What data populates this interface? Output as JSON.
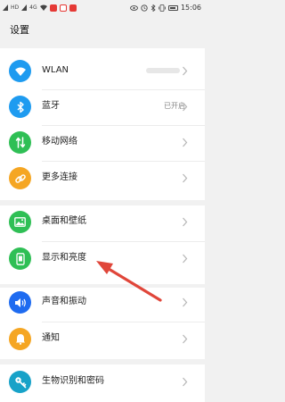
{
  "status_bar": {
    "network_label_1": "HD",
    "network_label_2": "4G",
    "time": "15:06",
    "colors": {
      "notification_red": "#e53935"
    }
  },
  "page": {
    "title": "设置"
  },
  "sections": [
    {
      "items": [
        {
          "label": "WLAN",
          "value": "",
          "icon": "wifi-icon",
          "color": "#1e9bf0"
        },
        {
          "label": "蓝牙",
          "value": "已开启",
          "icon": "bluetooth-icon",
          "color": "#1e9bf0"
        },
        {
          "label": "移动网络",
          "value": "",
          "icon": "mobile-network-icon",
          "color": "#2fbf55"
        },
        {
          "label": "更多连接",
          "value": "",
          "icon": "link-icon",
          "color": "#f5a623"
        }
      ]
    },
    {
      "items": [
        {
          "label": "桌面和壁纸",
          "value": "",
          "icon": "wallpaper-icon",
          "color": "#2fbf55"
        },
        {
          "label": "显示和亮度",
          "value": "",
          "icon": "display-icon",
          "color": "#2fbf55"
        }
      ]
    },
    {
      "items": [
        {
          "label": "声音和振动",
          "value": "",
          "icon": "sound-icon",
          "color": "#1e6bf0"
        },
        {
          "label": "通知",
          "value": "",
          "icon": "notification-icon",
          "color": "#f5a623"
        }
      ]
    },
    {
      "items": [
        {
          "label": "生物识别和密码",
          "value": "",
          "icon": "key-icon",
          "color": "#17a2c8"
        }
      ]
    }
  ],
  "annotation": {
    "icon": "red-arrow-icon",
    "color": "#e0463a"
  }
}
